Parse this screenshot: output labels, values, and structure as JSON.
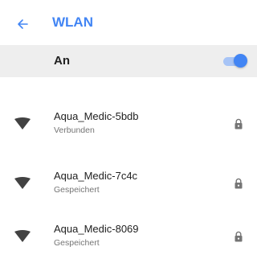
{
  "appbar": {
    "back_icon": "arrow-back-icon",
    "title": "WLAN"
  },
  "master_switch": {
    "label": "An",
    "state": "on"
  },
  "colors": {
    "accent": "#4285f4",
    "text_primary": "#212121",
    "text_secondary": "#757575",
    "master_bg": "#eeeeee"
  },
  "networks": [
    {
      "name": "Aqua_Medic-5bdb",
      "status": "Verbunden",
      "icon": "wifi-icon",
      "secured_icon": "lock-icon"
    },
    {
      "name": "Aqua_Medic-7c4c",
      "status": "Gespeichert",
      "icon": "wifi-icon",
      "secured_icon": "lock-icon"
    },
    {
      "name": "Aqua_Medic-8069",
      "status": "Gespeichert",
      "icon": "wifi-icon",
      "secured_icon": "lock-icon"
    }
  ]
}
